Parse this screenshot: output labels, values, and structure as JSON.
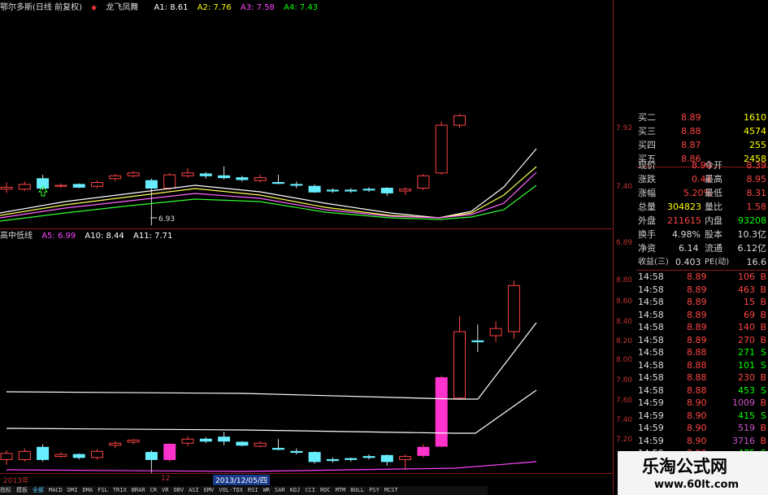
{
  "top_panel": {
    "title": "鄂尔多斯(日线 前复权)",
    "indicator": "龙飞凤舞",
    "a1": "A1: 8.61",
    "a2": "A2: 7.76",
    "a3": "A3: 7.58",
    "a4": "A4: 7.43",
    "low_label": "6.93",
    "colors": {
      "a1": "#ffffff",
      "a2": "#ffff00",
      "a3": "#ff44ff",
      "a4": "#00ff00"
    }
  },
  "bottom_panel": {
    "title": "高中低线",
    "a5": "A5: 6.99",
    "a10": "A10: 8.44",
    "a11": "A11: 7.71",
    "colors": {
      "a5": "#ff44ff",
      "a10": "#ffffff",
      "a11": "#ffffff"
    }
  },
  "axis": {
    "top_ticks": [
      "7.92",
      "7.40",
      "6.89"
    ],
    "bottom_ticks": [
      "8.80",
      "8.60",
      "8.40",
      "8.20",
      "8.00",
      "7.80",
      "7.60",
      "7.40",
      "7.20"
    ],
    "x_labels": [
      "2013年",
      "12"
    ],
    "date_box": "2013/12/05/四"
  },
  "order_book": [
    {
      "label": "买二",
      "price": "8.89",
      "vol": "1610"
    },
    {
      "label": "买三",
      "price": "8.88",
      "vol": "4574"
    },
    {
      "label": "买四",
      "price": "8.87",
      "vol": "255"
    },
    {
      "label": "买五",
      "price": "8.86",
      "vol": "2458"
    }
  ],
  "quote": [
    {
      "l1": "现价",
      "v1": "8.90",
      "l2": "今开",
      "v2": "8.39"
    },
    {
      "l1": "涨跌",
      "v1": "0.44",
      "l2": "最高",
      "v2": "8.95"
    },
    {
      "l1": "涨幅",
      "v1": "5.20%",
      "l2": "最低",
      "v2": "8.31"
    },
    {
      "l1": "总量",
      "v1": "304823",
      "l2": "量比",
      "v2": "1.58"
    },
    {
      "l1": "外盘",
      "v1": "211615",
      "l2": "内盘",
      "v2": "93208"
    },
    {
      "l1": "换手",
      "v1": "4.98%",
      "l2": "股本",
      "v2": "10.3亿"
    },
    {
      "l1": "净资",
      "v1": "6.14",
      "l2": "流通",
      "v2": "6.12亿"
    },
    {
      "l1": "收益(三)",
      "v1": "0.403",
      "l2": "PE(动)",
      "v2": "16.6"
    }
  ],
  "ticks": [
    {
      "time": "14:58",
      "price": "8.89",
      "vol": "106",
      "side": "B"
    },
    {
      "time": "14:58",
      "price": "8.89",
      "vol": "463",
      "side": "B"
    },
    {
      "time": "14:58",
      "price": "8.89",
      "vol": "15",
      "side": "B"
    },
    {
      "time": "14:58",
      "price": "8.89",
      "vol": "69",
      "side": "B"
    },
    {
      "time": "14:58",
      "price": "8.89",
      "vol": "140",
      "side": "B"
    },
    {
      "time": "14:58",
      "price": "8.89",
      "vol": "270",
      "side": "B"
    },
    {
      "time": "14:58",
      "price": "8.88",
      "vol": "271",
      "side": "S"
    },
    {
      "time": "14:58",
      "price": "8.88",
      "vol": "101",
      "side": "S"
    },
    {
      "time": "14:58",
      "price": "8.88",
      "vol": "230",
      "side": "B"
    },
    {
      "time": "14:58",
      "price": "8.88",
      "vol": "453",
      "side": "S"
    },
    {
      "time": "14:59",
      "price": "8.90",
      "vol": "1009",
      "side": "B"
    },
    {
      "time": "14:59",
      "price": "8.90",
      "vol": "415",
      "side": "S"
    },
    {
      "time": "14:59",
      "price": "8.90",
      "vol": "519",
      "side": "B"
    },
    {
      "time": "14:59",
      "price": "8.90",
      "vol": "3716",
      "side": "B"
    },
    {
      "time": "14:59",
      "price": "8.90",
      "vol": "475",
      "side": "S"
    },
    {
      "time": "14:59",
      "price": "8.91",
      "vol": "22",
      "side": "B"
    }
  ],
  "tabs": [
    "指标",
    "模板",
    "全部",
    "MACD",
    "DMI",
    "DMA",
    "FSL",
    "TRIX",
    "BRAR",
    "CR",
    "VR",
    "OBV",
    "ASI",
    "EMV",
    "VOL-TDX",
    "RSI",
    "WR",
    "SAR",
    "KDJ",
    "CCI",
    "ROC",
    "MTM",
    "BOLL",
    "PSY",
    "MCST"
  ],
  "logo": {
    "line1": "乐淘公式网",
    "line2": "www.60lt.com"
  },
  "chart_data": [
    {
      "type": "candlestick",
      "title": "鄂尔多斯(日线 前复权)",
      "ylim": [
        6.89,
        8.1
      ],
      "candles": [
        {
          "o": 7.31,
          "c": 7.33,
          "h": 7.38,
          "l": 7.27,
          "dir": "up"
        },
        {
          "o": 7.31,
          "c": 7.36,
          "h": 7.39,
          "l": 7.29,
          "dir": "up"
        },
        {
          "o": 7.42,
          "c": 7.32,
          "h": 7.46,
          "l": 7.3,
          "dir": "down"
        },
        {
          "o": 7.34,
          "c": 7.35,
          "h": 7.37,
          "l": 7.32,
          "dir": "up"
        },
        {
          "o": 7.36,
          "c": 7.33,
          "h": 7.37,
          "l": 7.32,
          "dir": "down"
        },
        {
          "o": 7.34,
          "c": 7.38,
          "h": 7.4,
          "l": 7.32,
          "dir": "up"
        },
        {
          "o": 7.42,
          "c": 7.45,
          "h": 7.47,
          "l": 7.39,
          "dir": "up"
        },
        {
          "o": 7.45,
          "c": 7.48,
          "h": 7.5,
          "l": 7.43,
          "dir": "up"
        },
        {
          "o": 7.4,
          "c": 7.32,
          "h": 7.42,
          "l": 6.93,
          "dir": "down"
        },
        {
          "o": 7.32,
          "c": 7.46,
          "h": 7.48,
          "l": 7.3,
          "dir": "up"
        },
        {
          "o": 7.45,
          "c": 7.48,
          "h": 7.53,
          "l": 7.43,
          "dir": "up"
        },
        {
          "o": 7.47,
          "c": 7.45,
          "h": 7.49,
          "l": 7.42,
          "dir": "down"
        },
        {
          "o": 7.45,
          "c": 7.43,
          "h": 7.55,
          "l": 7.41,
          "dir": "down"
        },
        {
          "o": 7.43,
          "c": 7.41,
          "h": 7.45,
          "l": 7.39,
          "dir": "down"
        },
        {
          "o": 7.4,
          "c": 7.43,
          "h": 7.46,
          "l": 7.38,
          "dir": "up"
        },
        {
          "o": 7.38,
          "c": 7.37,
          "h": 7.46,
          "l": 7.36,
          "dir": "down"
        },
        {
          "o": 7.36,
          "c": 7.35,
          "h": 7.39,
          "l": 7.32,
          "dir": "down"
        },
        {
          "o": 7.34,
          "c": 7.28,
          "h": 7.36,
          "l": 7.27,
          "dir": "down"
        },
        {
          "o": 7.3,
          "c": 7.29,
          "h": 7.32,
          "l": 7.27,
          "dir": "down"
        },
        {
          "o": 7.3,
          "c": 7.29,
          "h": 7.32,
          "l": 7.27,
          "dir": "down"
        },
        {
          "o": 7.31,
          "c": 7.3,
          "h": 7.33,
          "l": 7.28,
          "dir": "down"
        },
        {
          "o": 7.32,
          "c": 7.27,
          "h": 7.33,
          "l": 7.24,
          "dir": "down"
        },
        {
          "o": 7.29,
          "c": 7.31,
          "h": 7.33,
          "l": 7.25,
          "dir": "up"
        },
        {
          "o": 7.32,
          "c": 7.45,
          "h": 7.47,
          "l": 7.3,
          "dir": "up"
        },
        {
          "o": 7.48,
          "c": 7.98,
          "h": 8.02,
          "l": 7.46,
          "dir": "up"
        },
        {
          "o": 7.98,
          "c": 8.08,
          "h": 8.1,
          "l": 7.95,
          "dir": "up"
        }
      ]
    },
    {
      "type": "candlestick",
      "title": "高中低线",
      "ylim": [
        7.1,
        8.95
      ],
      "candles": [
        {
          "o": 7.2,
          "c": 7.26,
          "h": 7.29,
          "l": 7.15,
          "dir": "up"
        },
        {
          "o": 7.2,
          "c": 7.28,
          "h": 7.31,
          "l": 7.18,
          "dir": "up"
        },
        {
          "o": 7.32,
          "c": 7.2,
          "h": 7.35,
          "l": 7.18,
          "dir": "down"
        },
        {
          "o": 7.23,
          "c": 7.25,
          "h": 7.27,
          "l": 7.22,
          "dir": "up"
        },
        {
          "o": 7.25,
          "c": 7.22,
          "h": 7.26,
          "l": 7.2,
          "dir": "down"
        },
        {
          "o": 7.22,
          "c": 7.28,
          "h": 7.3,
          "l": 7.2,
          "dir": "up"
        },
        {
          "o": 7.34,
          "c": 7.36,
          "h": 7.38,
          "l": 7.31,
          "dir": "up"
        },
        {
          "o": 7.37,
          "c": 7.39,
          "h": 7.4,
          "l": 7.35,
          "dir": "up"
        },
        {
          "o": 7.27,
          "c": 7.2,
          "h": 7.29,
          "l": 7.07,
          "dir": "down"
        },
        {
          "o": 7.2,
          "c": 7.35,
          "h": 7.36,
          "l": 7.18,
          "dir": "up",
          "fill": "magenta"
        },
        {
          "o": 7.36,
          "c": 7.4,
          "h": 7.43,
          "l": 7.33,
          "dir": "up"
        },
        {
          "o": 7.4,
          "c": 7.38,
          "h": 7.42,
          "l": 7.36,
          "dir": "down"
        },
        {
          "o": 7.42,
          "c": 7.38,
          "h": 7.47,
          "l": 7.34,
          "dir": "down"
        },
        {
          "o": 7.37,
          "c": 7.34,
          "h": 7.38,
          "l": 7.33,
          "dir": "down"
        },
        {
          "o": 7.33,
          "c": 7.36,
          "h": 7.38,
          "l": 7.32,
          "dir": "up"
        },
        {
          "o": 7.31,
          "c": 7.3,
          "h": 7.4,
          "l": 7.29,
          "dir": "down"
        },
        {
          "o": 7.28,
          "c": 7.27,
          "h": 7.31,
          "l": 7.25,
          "dir": "down"
        },
        {
          "o": 7.27,
          "c": 7.18,
          "h": 7.28,
          "l": 7.16,
          "dir": "down"
        },
        {
          "o": 7.2,
          "c": 7.19,
          "h": 7.22,
          "l": 7.17,
          "dir": "down"
        },
        {
          "o": 7.21,
          "c": 7.2,
          "h": 7.22,
          "l": 7.18,
          "dir": "down"
        },
        {
          "o": 7.23,
          "c": 7.22,
          "h": 7.25,
          "l": 7.2,
          "dir": "down"
        },
        {
          "o": 7.24,
          "c": 7.18,
          "h": 7.25,
          "l": 7.14,
          "dir": "down"
        },
        {
          "o": 7.2,
          "c": 7.23,
          "h": 7.25,
          "l": 7.1,
          "dir": "up"
        },
        {
          "o": 7.24,
          "c": 7.32,
          "h": 7.35,
          "l": 7.22,
          "dir": "up",
          "fill": "magenta"
        },
        {
          "o": 7.33,
          "c": 8.0,
          "h": 8.02,
          "l": 7.32,
          "dir": "up",
          "fill": "magenta"
        },
        {
          "o": 7.8,
          "c": 8.45,
          "h": 8.6,
          "l": 7.78,
          "dir": "up"
        },
        {
          "o": 8.35,
          "c": 8.36,
          "h": 8.52,
          "l": 8.25,
          "dir": "down"
        },
        {
          "o": 8.41,
          "c": 8.48,
          "h": 8.55,
          "l": 8.35,
          "dir": "up"
        },
        {
          "o": 8.45,
          "c": 8.9,
          "h": 8.95,
          "l": 8.38,
          "dir": "up"
        }
      ]
    }
  ]
}
